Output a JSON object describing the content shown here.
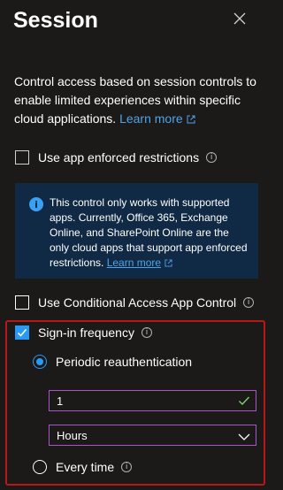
{
  "panel": {
    "title": "Session",
    "description": "Control access based on session controls to enable limited experiences within specific cloud applications.",
    "learn_more": "Learn more"
  },
  "options": {
    "app_enforced": {
      "label": "Use app enforced restrictions",
      "checked": false
    },
    "notice": {
      "text": "This control only works with supported apps. Currently, Office 365, Exchange Online, and SharePoint Online are the only cloud apps that support app enforced restrictions.",
      "learn_more": "Learn more"
    },
    "conditional_access": {
      "label": "Use Conditional Access App Control",
      "checked": false
    },
    "signin_frequency": {
      "label": "Sign-in frequency",
      "checked": true,
      "periodic": {
        "label": "Periodic reauthentication",
        "selected": true
      },
      "value": "1",
      "unit": "Hours",
      "every_time": {
        "label": "Every time",
        "selected": false
      }
    }
  },
  "colors": {
    "background": "#1b1a19",
    "accent": "#2899f5",
    "link": "#4fa3e8",
    "highlight_frame": "#b81818",
    "field_border": "#a855c7",
    "notice_bg": "#102a45"
  }
}
